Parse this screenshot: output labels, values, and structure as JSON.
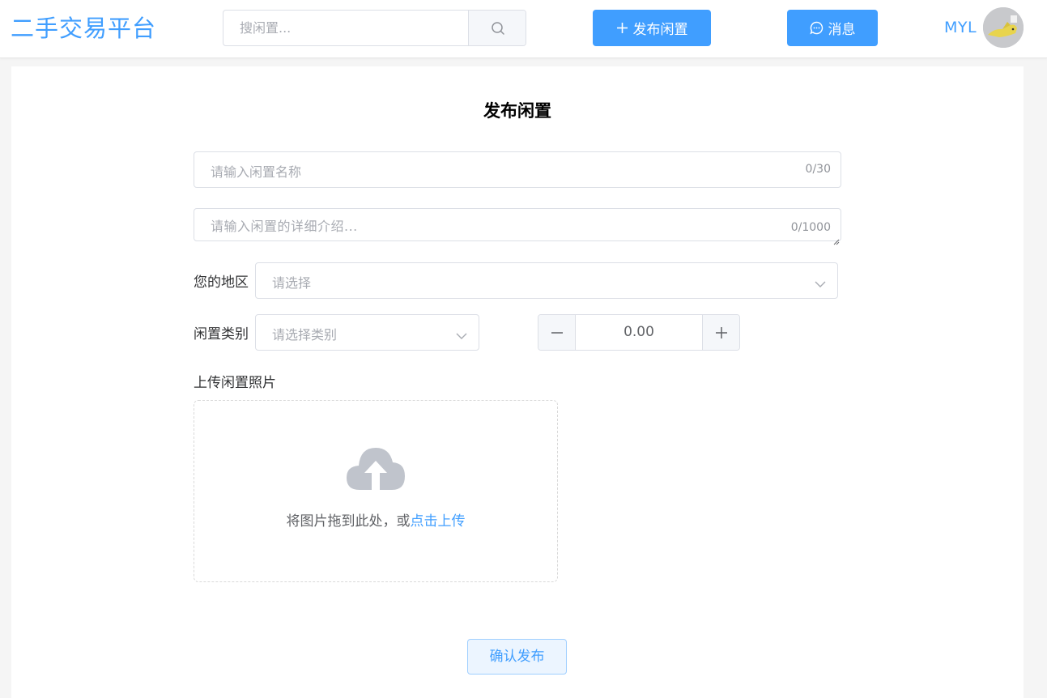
{
  "header": {
    "brand": "二手交易平台",
    "search_placeholder": "搜闲置...",
    "publish_label": "发布闲置",
    "message_label": "消息",
    "username": "MYL"
  },
  "form": {
    "title": "发布闲置",
    "name_placeholder": "请输入闲置名称",
    "name_count": "0/30",
    "desc_placeholder": "请输入闲置的详细介绍...",
    "desc_count": "0/1000",
    "region_label": "您的地区",
    "region_placeholder": "请选择",
    "category_label": "闲置类别",
    "category_placeholder": "请选择类别",
    "price_value": "0.00",
    "upload_label": "上传闲置照片",
    "upload_hint": "将图片拖到此处，或",
    "upload_link": "点击上传",
    "submit_label": "确认发布"
  },
  "colors": {
    "primary": "#409eff",
    "border": "#dcdfe6",
    "placeholder": "#a8abb2",
    "upload_icon": "#c0c4cc"
  },
  "icons": [
    "search-icon",
    "plus-icon",
    "chat-icon",
    "chevron-down-icon",
    "minus-icon",
    "upload-cloud-icon",
    "resize-grip-icon"
  ]
}
